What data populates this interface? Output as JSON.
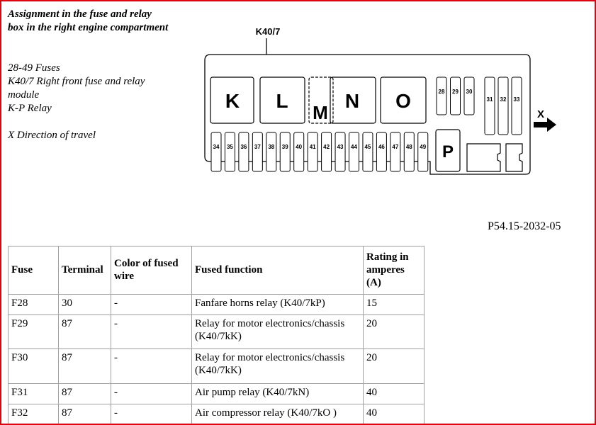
{
  "legend": {
    "title_line1": "Assignment in the fuse and relay",
    "title_line2": "box in the right engine compartment",
    "items": [
      "28-49 Fuses",
      "K40/7 Right front fuse and relay",
      "module",
      "K-P Relay"
    ],
    "direction": "X Direction of travel"
  },
  "diagram": {
    "module_label": "K40/7",
    "relays": [
      "K",
      "L",
      "M",
      "N",
      "O",
      "P"
    ],
    "fuses_top_small": [
      "28",
      "29",
      "30"
    ],
    "fuses_top_tall": [
      "31",
      "32",
      "33"
    ],
    "fuses_bottom": [
      "34",
      "35",
      "36",
      "37",
      "38",
      "39",
      "40",
      "41",
      "42",
      "43",
      "44",
      "45",
      "46",
      "47",
      "48",
      "49"
    ],
    "direction_label": "X",
    "figure_id": "P54.15-2032-05"
  },
  "table": {
    "headers": [
      "Fuse",
      "Terminal",
      "Color of fused wire",
      "Fused function",
      "Rating in amperes (A)"
    ],
    "rows": [
      [
        "F28",
        "30",
        "-",
        "Fanfare horns relay (K40/7kP)",
        "15"
      ],
      [
        "F29",
        "87",
        "-",
        "Relay for motor electronics/chassis (K40/7kK)",
        "20"
      ],
      [
        "F30",
        "87",
        "-",
        "Relay for motor electronics/chassis (K40/7kK)",
        "20"
      ],
      [
        "F31",
        "87",
        "-",
        "Air pump relay (K40/7kN)",
        "40"
      ],
      [
        "F32",
        "87",
        "-",
        "Air compressor relay (K40/7kO )",
        "40"
      ]
    ]
  },
  "colors": {
    "frame": "#e8000b",
    "table_border": "#a0a0a0"
  }
}
